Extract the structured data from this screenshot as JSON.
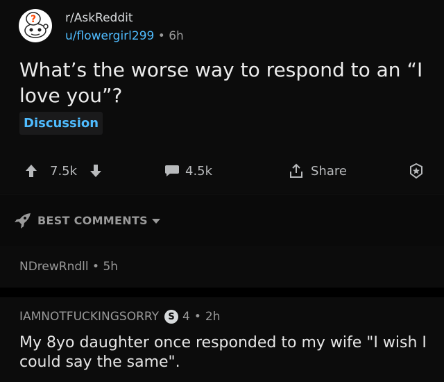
{
  "post": {
    "subreddit": "r/AskReddit",
    "author": "u/flowergirl299",
    "separator": "•",
    "age": "6h",
    "title": "What’s the worse way to respond to an “I love you”?",
    "flair": "Discussion",
    "upvotes": "7.5k",
    "comments": "4.5k",
    "share_label": "Share"
  },
  "sort": {
    "label": "BEST COMMENTS"
  },
  "comments": [
    {
      "author": "NDrewRndll",
      "separator": "•",
      "age": "5h"
    },
    {
      "author": "IAMNOTFUCKINGSORRY",
      "badge": "S",
      "score": "4",
      "separator": "•",
      "age": "2h",
      "body": "My 8yo daughter once responded to my wife \"I wish I could say the same\"."
    }
  ],
  "colors": {
    "link_blue": "#4fbcff",
    "background": "#000000",
    "card": "#0c0c0c"
  }
}
